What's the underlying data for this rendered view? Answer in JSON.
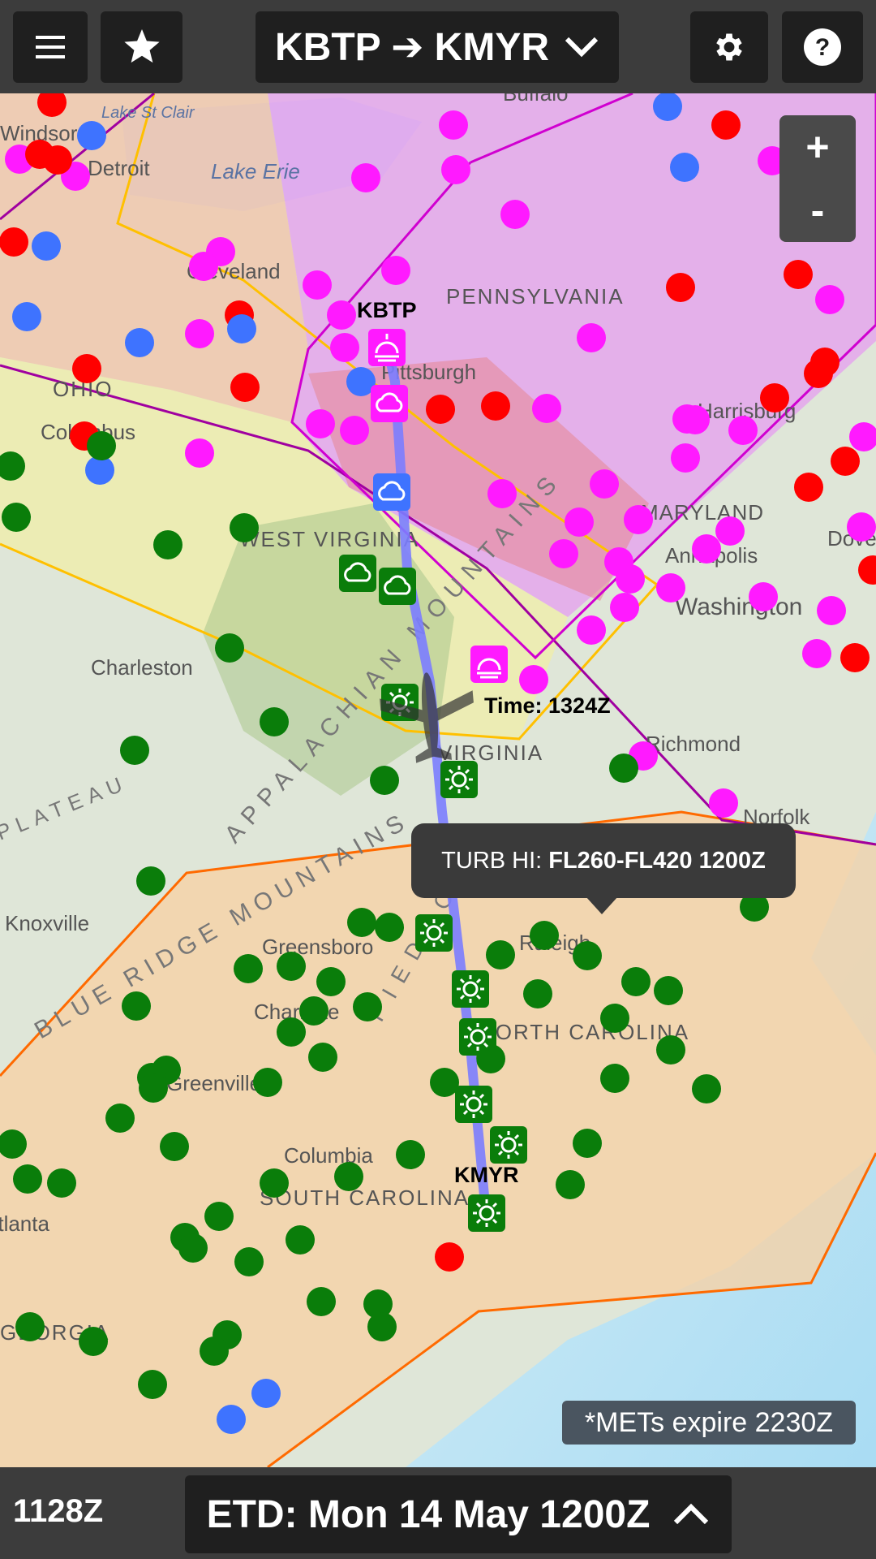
{
  "toolbar": {
    "route_label": "KBTP ➔ KMYR",
    "menu_icon": "hamburger-menu-icon",
    "favorite_icon": "star-icon",
    "settings_icon": "gear-icon",
    "help_icon": "help-icon"
  },
  "zoom": {
    "in_label": "+",
    "out_label": "-"
  },
  "map": {
    "departure": "KBTP",
    "destination": "KMYR",
    "aircraft_time": "Time: 1324Z",
    "tooltip_prefix": "TURB HI:",
    "tooltip_value": "FL260-FL420 1200Z",
    "mets_note": "*METs expire 2230Z",
    "place_labels": [
      "Buffalo",
      "Windsor",
      "Detroit",
      "Lake Erie",
      "Lake St Clair",
      "Cleveland",
      "PENNSYLVANIA",
      "Pittsburgh",
      "OHIO",
      "Columbus",
      "Harrisburg",
      "WEST VIRGINIA",
      "MARYLAND",
      "Annapolis",
      "Washington",
      "Dover",
      "Charleston",
      "VIRGINIA",
      "Richmond",
      "Norfolk",
      "Knoxville",
      "Greensboro",
      "Raleigh",
      "Charlotte",
      "NORTH CAROLINA",
      "Greenville",
      "Columbia",
      "SOUTH CAROLINA",
      "Atlanta",
      "GEORGIA",
      "APPALACHIAN MOUNTAINS",
      "BLUE RIDGE MOUNTAINS",
      "PIEDMONT",
      "PLATEAU"
    ],
    "colors": {
      "magenta": "#ff1aff",
      "red": "#ff0000",
      "blue": "#3e73ff",
      "green": "#0a7d0a",
      "route": "#7b7dff",
      "airmet_orange": "#ff6a00",
      "airmet_yellow": "#ffc000",
      "airmet_purple": "#a000a0"
    }
  },
  "bottom": {
    "clock": "1128Z",
    "etd_label": "ETD: Mon 14 May 1200Z",
    "expand_icon": "chevron-up-icon"
  }
}
